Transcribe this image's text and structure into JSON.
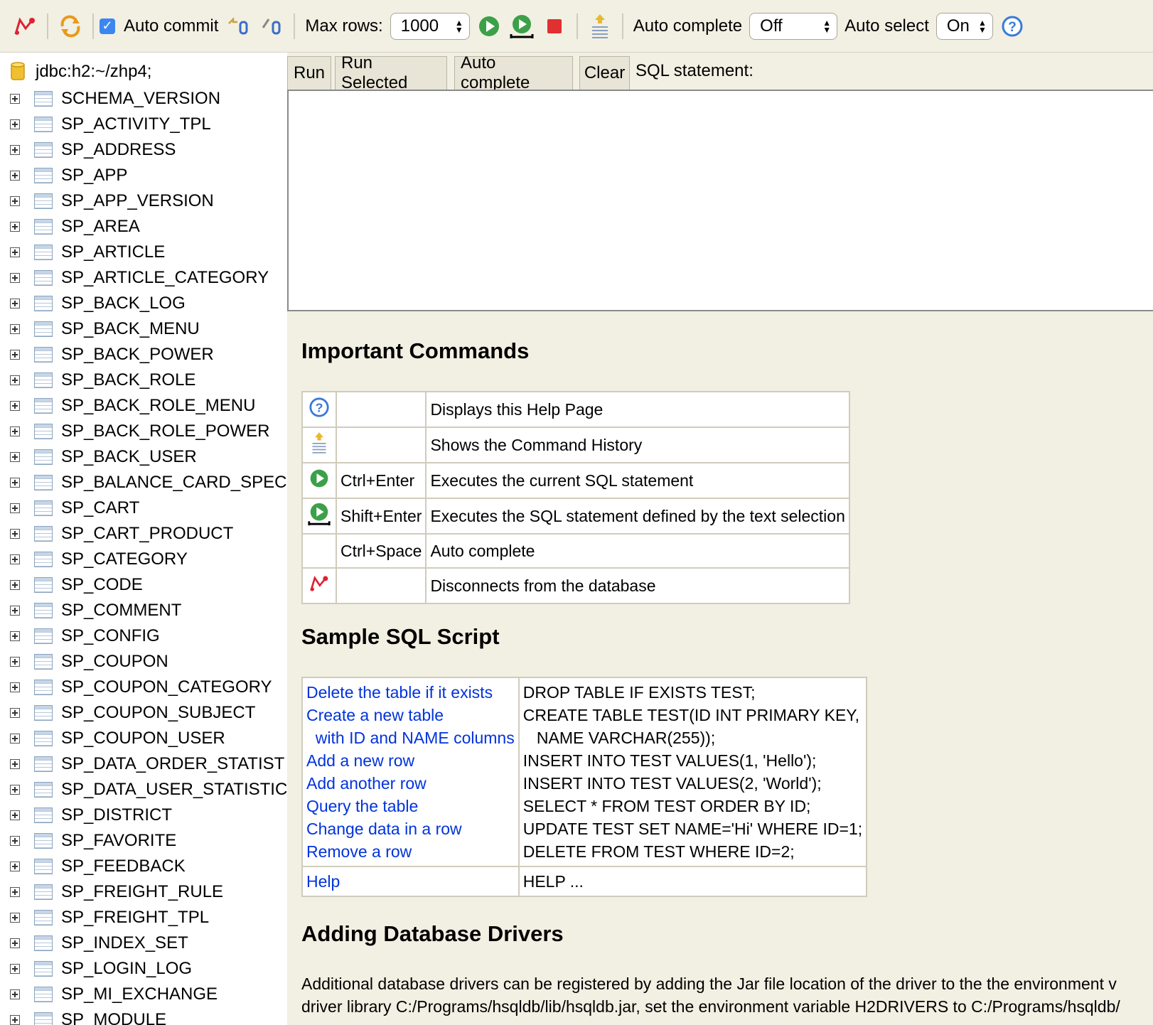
{
  "toolbar": {
    "auto_commit_label": "Auto commit",
    "max_rows_label": "Max rows:",
    "max_rows_value": "1000",
    "auto_complete_label": "Auto complete",
    "auto_complete_value": "Off",
    "auto_select_label": "Auto select",
    "auto_select_value": "On"
  },
  "sidebar": {
    "connection": "jdbc:h2:~/zhp4;",
    "tables": [
      "SCHEMA_VERSION",
      "SP_ACTIVITY_TPL",
      "SP_ADDRESS",
      "SP_APP",
      "SP_APP_VERSION",
      "SP_AREA",
      "SP_ARTICLE",
      "SP_ARTICLE_CATEGORY",
      "SP_BACK_LOG",
      "SP_BACK_MENU",
      "SP_BACK_POWER",
      "SP_BACK_ROLE",
      "SP_BACK_ROLE_MENU",
      "SP_BACK_ROLE_POWER",
      "SP_BACK_USER",
      "SP_BALANCE_CARD_SPEC",
      "SP_CART",
      "SP_CART_PRODUCT",
      "SP_CATEGORY",
      "SP_CODE",
      "SP_COMMENT",
      "SP_CONFIG",
      "SP_COUPON",
      "SP_COUPON_CATEGORY",
      "SP_COUPON_SUBJECT",
      "SP_COUPON_USER",
      "SP_DATA_ORDER_STATIST",
      "SP_DATA_USER_STATISTIC",
      "SP_DISTRICT",
      "SP_FAVORITE",
      "SP_FEEDBACK",
      "SP_FREIGHT_RULE",
      "SP_FREIGHT_TPL",
      "SP_INDEX_SET",
      "SP_LOGIN_LOG",
      "SP_MI_EXCHANGE",
      "SP_MODULE"
    ]
  },
  "query": {
    "run": "Run",
    "run_selected": "Run Selected",
    "auto_complete": "Auto complete",
    "clear": "Clear",
    "sql_label": "SQL statement:"
  },
  "help": {
    "important_title": "Important Commands",
    "commands": [
      {
        "icon": "help-icon",
        "key": "",
        "desc": "Displays this Help Page"
      },
      {
        "icon": "history-icon",
        "key": "",
        "desc": "Shows the Command History"
      },
      {
        "icon": "run-icon",
        "key": "Ctrl+Enter",
        "desc": "Executes the current SQL statement"
      },
      {
        "icon": "run-selected-icon",
        "key": "Shift+Enter",
        "desc": "Executes the SQL statement defined by the text selection"
      },
      {
        "icon": "",
        "key": "Ctrl+Space",
        "desc": "Auto complete"
      },
      {
        "icon": "disconnect-icon",
        "key": "",
        "desc": "Disconnects from the database"
      }
    ],
    "sample_title": "Sample SQL Script",
    "sample_links": [
      "Delete the table if it exists",
      "Create a new table",
      "  with ID and NAME columns",
      "Add a new row",
      "Add another row",
      "Query the table",
      "Change data in a row",
      "Remove a row"
    ],
    "sample_sql": [
      "DROP TABLE IF EXISTS TEST;",
      "CREATE TABLE TEST(ID INT PRIMARY KEY,",
      "   NAME VARCHAR(255));",
      "INSERT INTO TEST VALUES(1, 'Hello');",
      "INSERT INTO TEST VALUES(2, 'World');",
      "SELECT * FROM TEST ORDER BY ID;",
      "UPDATE TEST SET NAME='Hi' WHERE ID=1;",
      "DELETE FROM TEST WHERE ID=2;"
    ],
    "help_link": "Help",
    "help_sql": "HELP ...",
    "drivers_title": "Adding Database Drivers",
    "drivers_text_1": "Additional database drivers can be registered by adding the Jar file location of the driver to the the environment v",
    "drivers_text_2": "driver library C:/Programs/hsqldb/lib/hsqldb.jar, set the environment variable H2DRIVERS to C:/Programs/hsqldb/"
  }
}
